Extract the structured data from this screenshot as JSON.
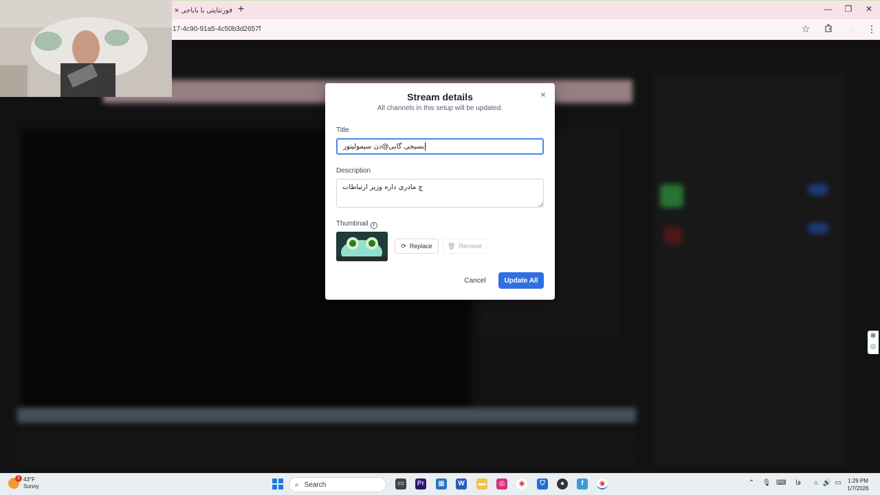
{
  "browser": {
    "tab_title": "فورتنایتی با باباجی",
    "tab_close": "×",
    "new_tab": "+",
    "url": "17-4c90-91a5-4c50b3d2657f",
    "window_controls": [
      "—",
      "❐",
      "✕"
    ]
  },
  "dialog": {
    "title": "Stream details",
    "subtitle": "All channels in this setup will be updated.",
    "close": "×",
    "title_label": "Title",
    "title_value": "بسیجی گایی@دن سیمولیتور",
    "description_label": "Description",
    "description_value": "چ مادری داره وزیر ارتباطات",
    "thumbnail_label": "Thumbnail",
    "replace_label": "Replace",
    "remove_label": "Remove",
    "cancel_label": "Cancel",
    "update_label": "Update All"
  },
  "taskbar": {
    "weather_temp": "43°F",
    "weather_desc": "Sunny",
    "weather_badge": "2",
    "search_placeholder": "Search",
    "lang": "فا",
    "time": "1:29 PM",
    "date": "1/7/2026"
  },
  "colors": {
    "accent": "#2f6fe4",
    "input_focus": "#4a86e8",
    "tabstrip": "#f6e3ea"
  }
}
